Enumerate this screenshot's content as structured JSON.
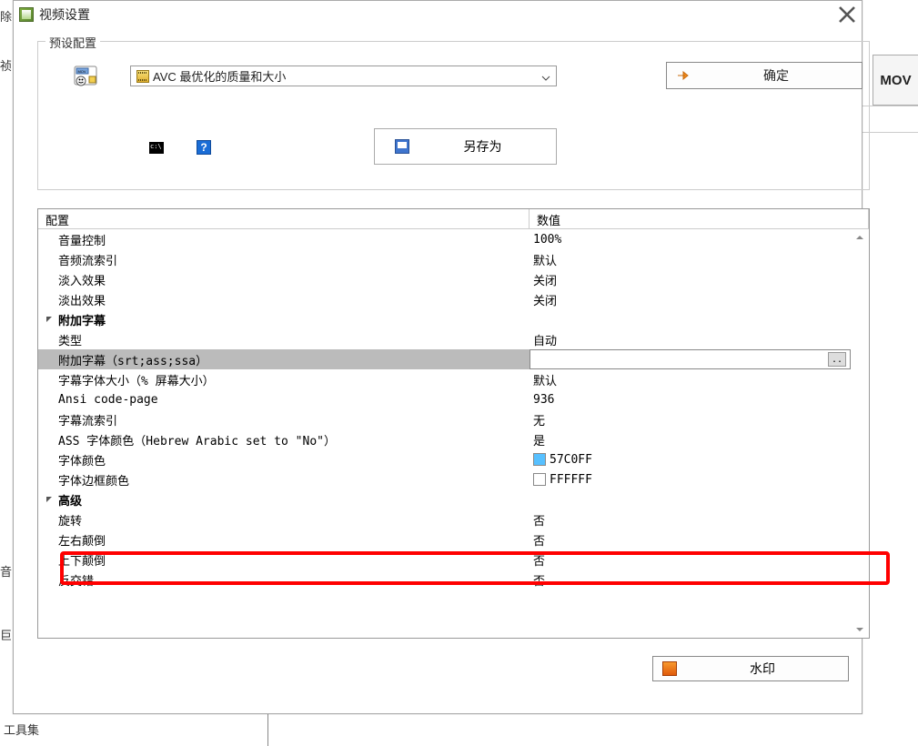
{
  "window": {
    "title": "视频设置",
    "close_tooltip": "关闭"
  },
  "preset": {
    "group_label": "预设配置",
    "selected": "AVC 最优化的质量和大小",
    "confirm": "确定",
    "save_as": "另存为"
  },
  "grid": {
    "col_name": "配置",
    "col_value": "数值",
    "rows": [
      {
        "type": "plain",
        "name": "音量控制",
        "value": "100%"
      },
      {
        "type": "plain",
        "name": "音频流索引",
        "value": "默认"
      },
      {
        "type": "plain",
        "name": "淡入效果",
        "value": "关闭"
      },
      {
        "type": "plain",
        "name": "淡出效果",
        "value": "关闭"
      },
      {
        "type": "cat",
        "name": "附加字幕",
        "value": ""
      },
      {
        "type": "plain",
        "name": "类型",
        "value": "自动"
      },
      {
        "type": "sel",
        "name": "附加字幕（srt;ass;ssa）",
        "value": ""
      },
      {
        "type": "plain",
        "name": "字幕字体大小（% 屏幕大小）",
        "value": "默认"
      },
      {
        "type": "plain",
        "name": "Ansi code-page",
        "value": "936"
      },
      {
        "type": "plain",
        "name": "字幕流索引",
        "value": "无"
      },
      {
        "type": "plain",
        "name": "ASS 字体颜色（Hebrew Arabic set to \"No\"）",
        "value": "是"
      },
      {
        "type": "color",
        "name": "字体颜色",
        "value": "57C0FF",
        "swatch": "#57C0FF"
      },
      {
        "type": "color",
        "name": "字体边框颜色",
        "value": "FFFFFF",
        "swatch": "#FFFFFF"
      },
      {
        "type": "cat",
        "name": "高级",
        "value": ""
      },
      {
        "type": "plain",
        "name": "旋转",
        "value": "否"
      },
      {
        "type": "plain",
        "name": "左右颠倒",
        "value": "否"
      },
      {
        "type": "plain",
        "name": "上下颠倒",
        "value": "否"
      },
      {
        "type": "plain",
        "name": "反交错",
        "value": "否"
      }
    ],
    "browse_label": ".."
  },
  "watermark": {
    "label": "水印"
  },
  "background": {
    "mov_label": "MOV",
    "bottom_text": "工具集"
  }
}
